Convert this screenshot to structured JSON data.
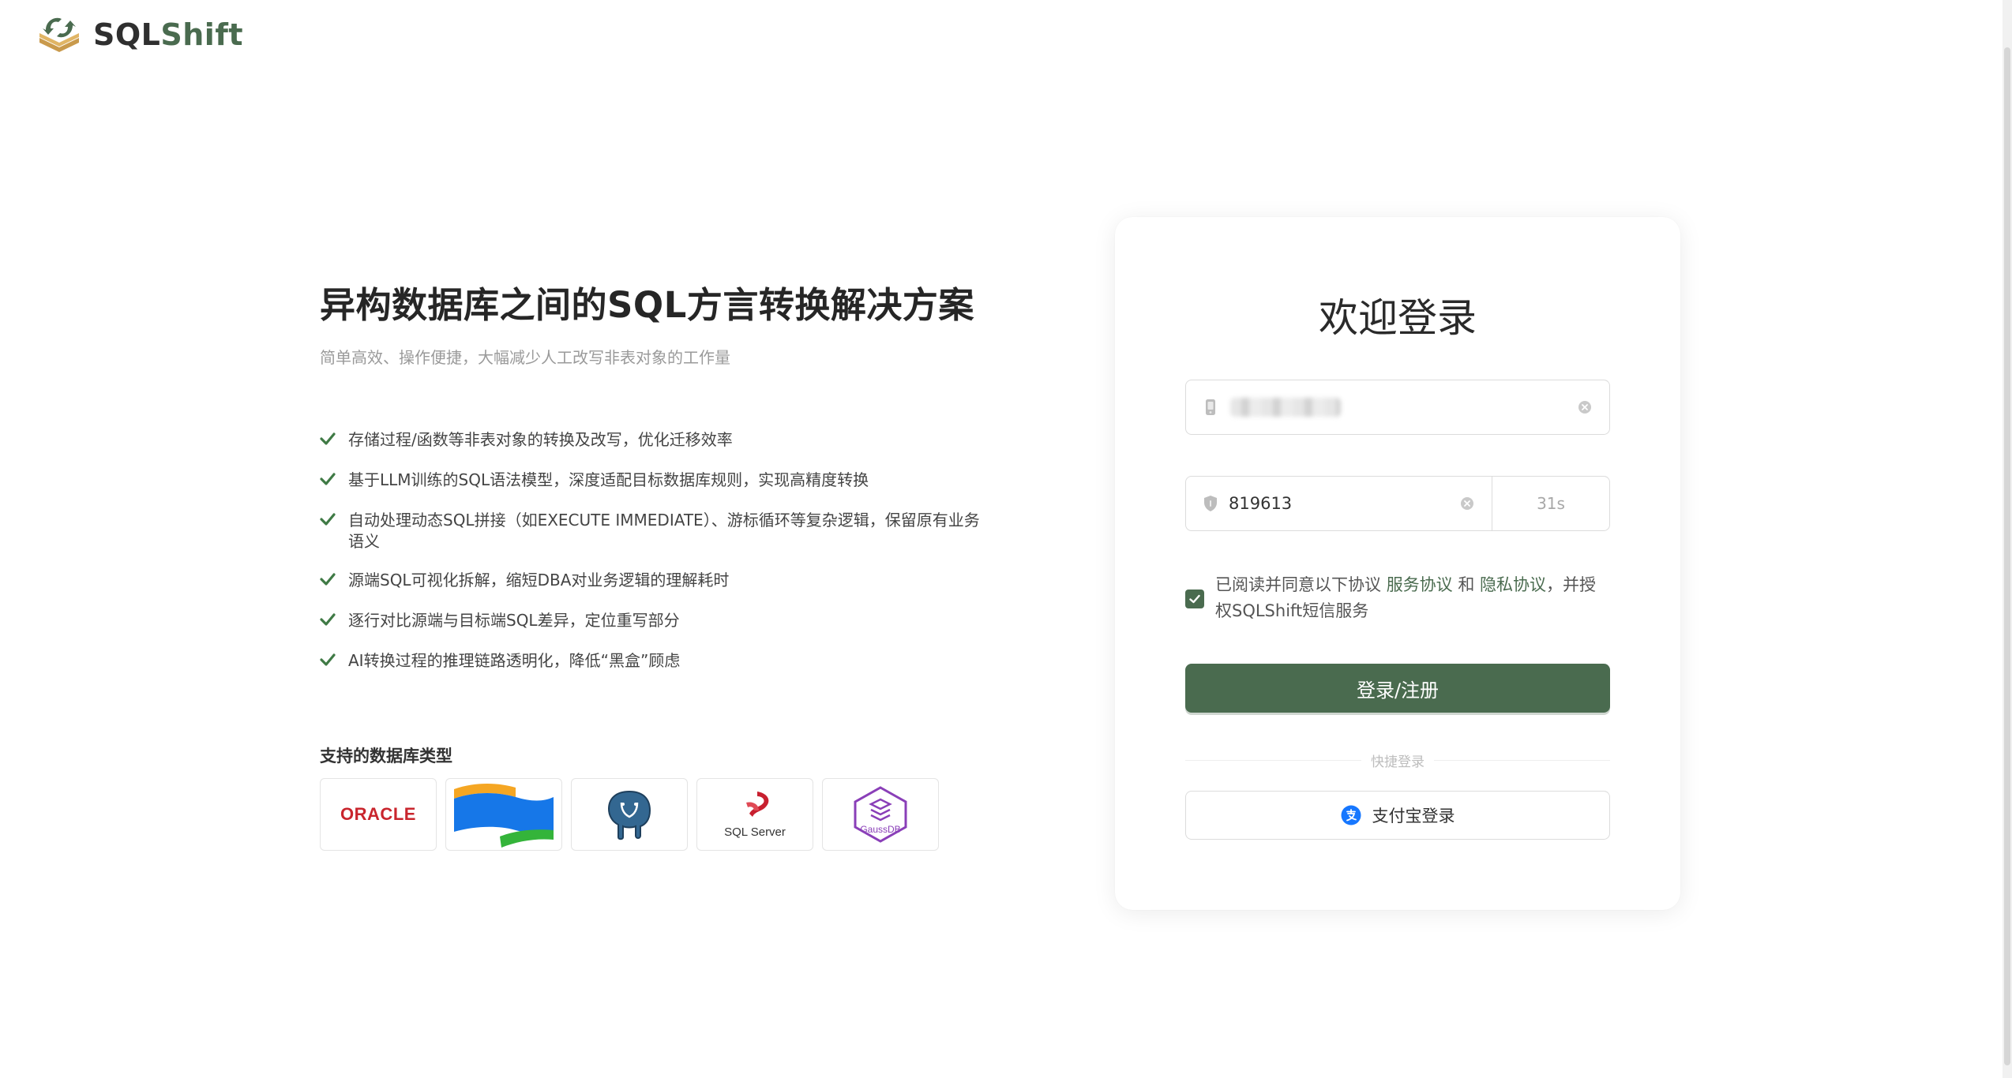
{
  "brand": {
    "name_part1": "SQL",
    "name_part2": "Shift",
    "accent_color": "#4a6b4f"
  },
  "intro": {
    "title": "异构数据库之间的SQL方言转换解决方案",
    "subtitle": "简单高效、操作便捷，大幅减少人工改写非表对象的工作量",
    "features": [
      "存储过程/函数等非表对象的转换及改写，优化迁移效率",
      "基于LLM训练的SQL语法模型，深度适配目标数据库规则，实现高精度转换",
      "自动处理动态SQL拼接（如EXECUTE IMMEDIATE）、游标循环等复杂逻辑，保留原有业务语义",
      "源端SQL可视化拆解，缩短DBA对业务逻辑的理解耗时",
      "逐行对比源端与目标端SQL差异，定位重写部分",
      "AI转换过程的推理链路透明化，降低“黑盒”顾虑"
    ]
  },
  "databases": {
    "title": "支持的数据库类型",
    "oracle_label": "ORACLE",
    "sqlserver_label": "SQL Server",
    "gaussdb_label": "GaussDB"
  },
  "login": {
    "title": "欢迎登录",
    "code_value": "819613",
    "countdown": "31s",
    "agree_prefix": "已阅读并同意以下协议 ",
    "service_link": "服务协议",
    "and_text": " 和 ",
    "privacy_link": "隐私协议",
    "agree_suffix": "，并授权SQLShift短信服务",
    "agree_checked": true,
    "submit_label": "登录/注册",
    "quick_login_label": "快捷登录",
    "alipay_label": "支付宝登录"
  }
}
